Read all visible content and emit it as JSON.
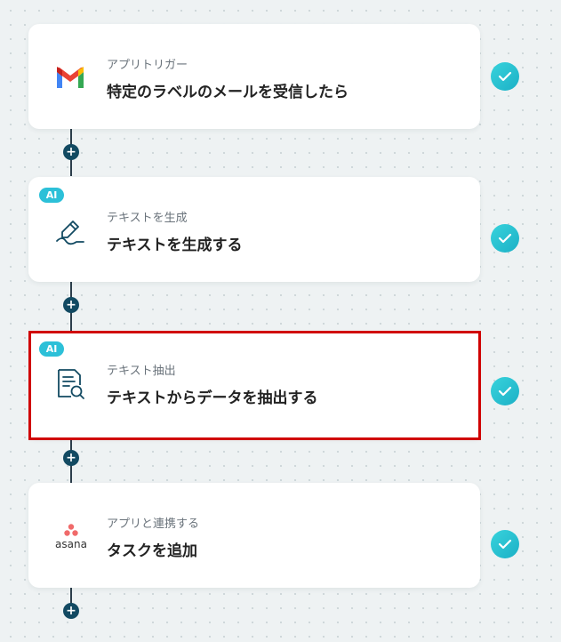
{
  "steps": [
    {
      "icon": "gmail-icon",
      "ai_badge": "",
      "sub_label": "アプリトリガー",
      "main_label": "特定のラベルのメールを受信したら",
      "status": "completed"
    },
    {
      "icon": "pen-icon",
      "ai_badge": "AI",
      "sub_label": "テキストを生成",
      "main_label": "テキストを生成する",
      "status": "completed"
    },
    {
      "icon": "document-search-icon",
      "ai_badge": "AI",
      "sub_label": "テキスト抽出",
      "main_label": "テキストからデータを抽出する",
      "status": "completed",
      "highlighted": true
    },
    {
      "icon": "asana-icon",
      "ai_badge": "",
      "sub_label": "アプリと連携する",
      "main_label": "タスクを追加",
      "status": "completed",
      "icon_text": "asana"
    }
  ],
  "plus_symbol": "+",
  "colors": {
    "check_gradient_start": "#38d3dc",
    "check_gradient_end": "#1cb0c6",
    "ai_badge": "#2cc0d8",
    "highlight_border": "#d00000",
    "connector": "#2c3e4b",
    "plus_button": "#124a62",
    "gmail_red": "#ea4335",
    "asana_coral": "#f06a6a"
  }
}
